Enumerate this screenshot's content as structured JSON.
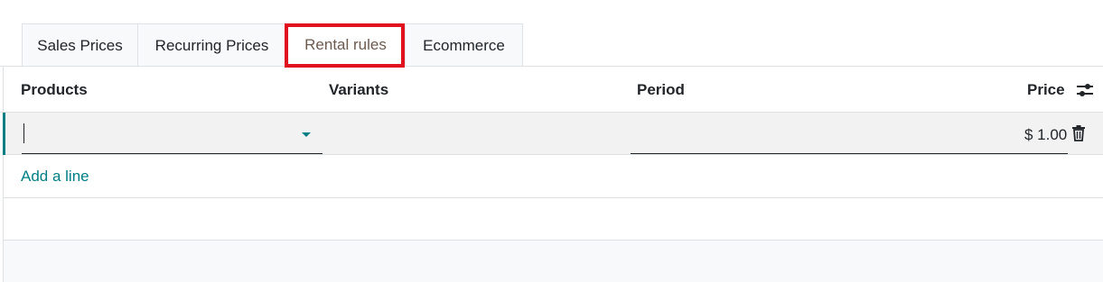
{
  "tabs": [
    {
      "label": "Sales Prices",
      "active": false
    },
    {
      "label": "Recurring Prices",
      "active": false
    },
    {
      "label": "Rental rules",
      "active": true
    },
    {
      "label": "Ecommerce",
      "active": false
    }
  ],
  "table": {
    "columns": {
      "products": "Products",
      "variants": "Variants",
      "period": "Period",
      "price": "Price"
    },
    "rows": [
      {
        "product": "",
        "variants": "",
        "period": "",
        "price": "$ 1.00"
      }
    ],
    "add_line_label": "Add a line"
  },
  "icons": {
    "column_settings": "sliders-icon",
    "delete": "trash-icon",
    "dropdown": "caret-down-icon"
  },
  "colors": {
    "accent": "#017e84",
    "highlight_box": "#e0101f"
  }
}
